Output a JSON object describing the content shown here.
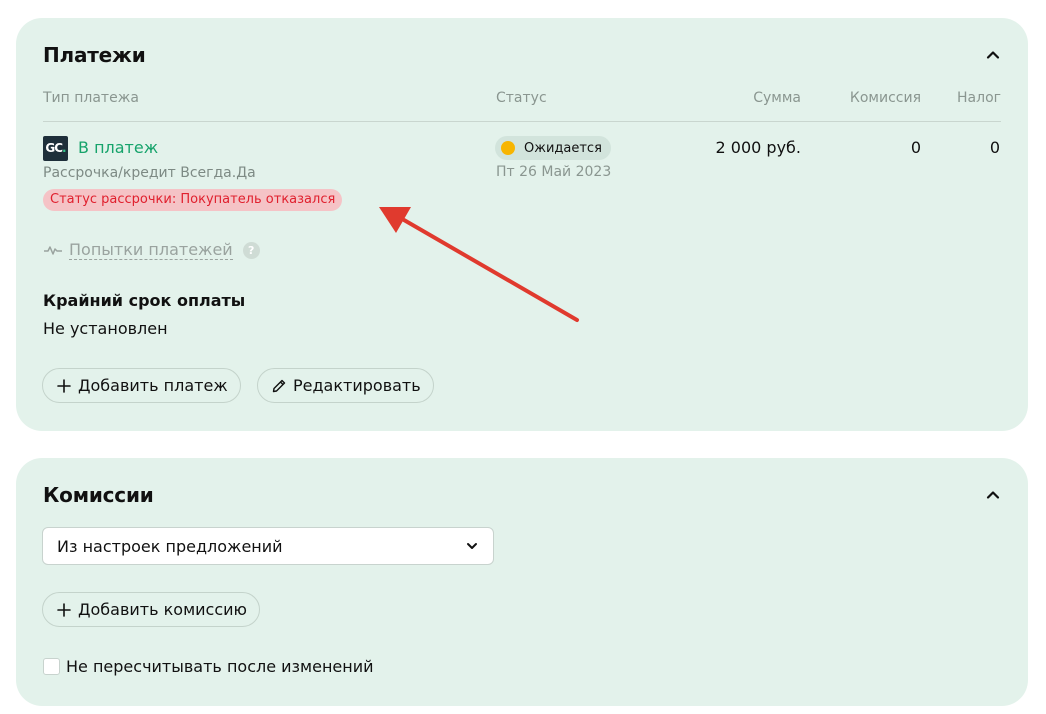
{
  "payments": {
    "title": "Платежи",
    "columns": {
      "type": "Тип платежа",
      "status": "Статус",
      "amount": "Сумма",
      "commission": "Комиссия",
      "tax": "Налог"
    },
    "row": {
      "logo_text": "GC",
      "logo_dot": ".",
      "link": "В платеж",
      "subtitle": "Рассрочка/кредит Всегда.Да",
      "alert": "Статус рассрочки: Покупатель отказался",
      "status": "Ожидается",
      "status_color": "#f7b500",
      "date": "Пт 26 Май 2023",
      "amount": "2 000 руб.",
      "commission": "0",
      "tax": "0"
    },
    "attempts": {
      "label": "Попытки платежей",
      "help": "?"
    },
    "deadline": {
      "label": "Крайний срок оплаты",
      "value": "Не установлен"
    },
    "buttons": {
      "add": "Добавить платеж",
      "edit": "Редактировать"
    }
  },
  "commissions": {
    "title": "Комиссии",
    "select_value": "Из настроек предложений",
    "add_button": "Добавить комиссию",
    "checkbox_label": "Не пересчитывать после изменений",
    "checkbox_checked": false
  },
  "colors": {
    "card_bg": "#e3f2eb",
    "link_green": "#16a36b",
    "alert_red": "#e0202e",
    "annotation_arrow": "#e03a2e"
  }
}
